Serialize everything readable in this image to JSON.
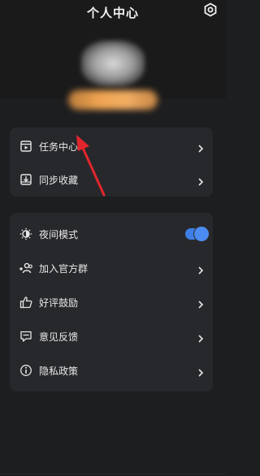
{
  "header": {
    "title": "个人中心"
  },
  "card1": {
    "items": [
      {
        "label": "任务中心"
      },
      {
        "label": "同步收藏"
      }
    ]
  },
  "card2": {
    "items": [
      {
        "label": "夜间模式",
        "toggle": true
      },
      {
        "label": "加入官方群"
      },
      {
        "label": "好评鼓励"
      },
      {
        "label": "意见反馈"
      },
      {
        "label": "隐私政策"
      }
    ]
  },
  "colors": {
    "background": "#1d1e20",
    "card": "#27282b",
    "accent": "#3d7fe6",
    "annotation_arrow": "#e3262d"
  }
}
